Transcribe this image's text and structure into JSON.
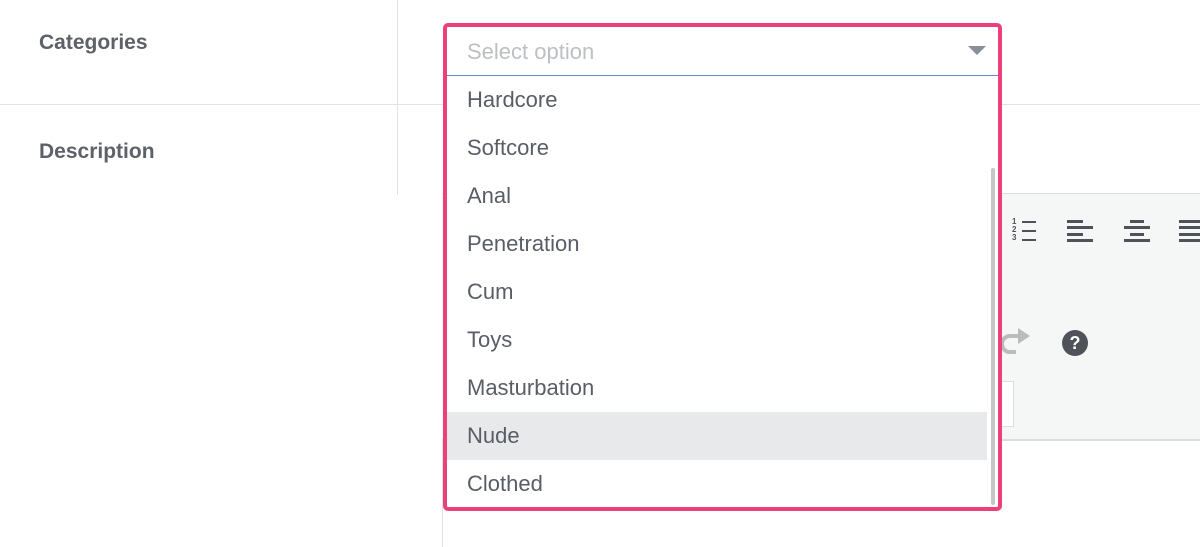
{
  "form": {
    "categories_label": "Categories",
    "description_label": "Description"
  },
  "dropdown": {
    "placeholder": "Select option",
    "options": [
      "Hardcore",
      "Softcore",
      "Anal",
      "Penetration",
      "Cum",
      "Toys",
      "Masturbation",
      "Nude",
      "Clothed"
    ],
    "highlighted": "Nude",
    "border_color": "#ec407a"
  },
  "editor": {
    "toolbar_icons": [
      "numbered-list-icon",
      "align-left-icon",
      "align-center-icon",
      "align-justify-icon",
      "redo-icon",
      "help-icon"
    ],
    "help_glyph": "?"
  }
}
